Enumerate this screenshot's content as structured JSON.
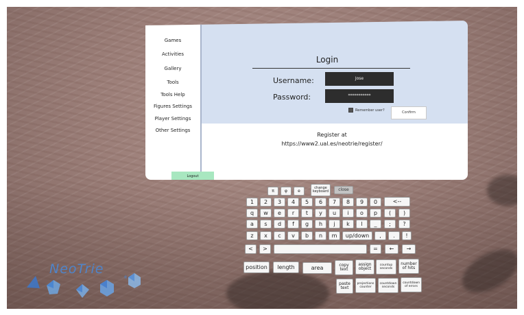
{
  "sidebar": {
    "items": [
      "Games",
      "Activities",
      "Gallery",
      "Tools",
      "Tools Help",
      "Figures Settings",
      "Player Settings",
      "Other Settings"
    ],
    "logout_label": "Logout"
  },
  "login": {
    "title": "Login",
    "username_label": "Username:",
    "username_value": "Jose",
    "password_label": "Password:",
    "password_value": "***********",
    "remember_label": "Remember user?",
    "confirm_label": "Confirm"
  },
  "register": {
    "line1": "Register at",
    "line2": "https://www2.ual.es/neotrie/register/"
  },
  "keyboard": {
    "top_row": [
      "π",
      "φ",
      "e",
      "change keyboard",
      "close"
    ],
    "number_row": [
      "1",
      "2",
      "3",
      "4",
      "5",
      "6",
      "7",
      "8",
      "9",
      "0",
      "<--"
    ],
    "row_q": [
      "q",
      "w",
      "e",
      "r",
      "t",
      "y",
      "u",
      "i",
      "o",
      "p",
      "(",
      ")"
    ],
    "row_a": [
      "a",
      "s",
      "d",
      "f",
      "g",
      "h",
      "j",
      "k",
      "l",
      "_",
      ";",
      "?"
    ],
    "row_z": [
      "z",
      "x",
      "c",
      "v",
      "b",
      "n",
      "m",
      "up/down",
      ",",
      ".",
      "!"
    ],
    "row_nav": [
      "<",
      ">",
      "=",
      "←",
      "→"
    ],
    "commands_row1": [
      "position",
      "length",
      "area",
      "copy text",
      "assign object",
      "countup seconds",
      "number of hits"
    ],
    "commands_row2": [
      "paste text",
      "projections counter",
      "countdown seconds",
      "countdown of errors"
    ]
  },
  "logo": {
    "text": "NeoTrie",
    "mark": "®"
  }
}
